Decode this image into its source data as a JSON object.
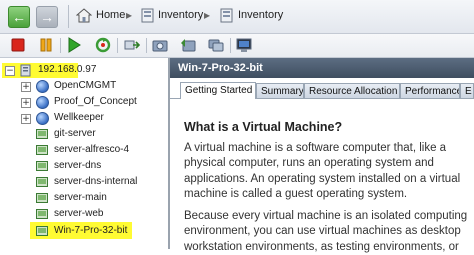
{
  "nav": {
    "back_icon": "back-arrow-icon",
    "forward_icon": "forward-arrow-icon",
    "breadcrumb": [
      {
        "label": "Home",
        "icon": "home-icon"
      },
      {
        "label": "Inventory",
        "icon": "inventory-icon"
      },
      {
        "label": "Inventory",
        "icon": "inventory-icon"
      }
    ]
  },
  "toolbar": {
    "buttons": [
      "stop-icon",
      "pause-icon",
      "play-icon",
      "reset-icon",
      "migrate-icon",
      "snapshot-icon",
      "revert-icon",
      "manage-snapshots-icon",
      "console-icon"
    ]
  },
  "tree": {
    "root": "192.168.0.97",
    "items": [
      {
        "label": "OpenCMGMT",
        "icon": "globe-icon",
        "expandable": true
      },
      {
        "label": "Proof_Of_Concept",
        "icon": "globe-icon",
        "expandable": true
      },
      {
        "label": "Wellkeeper",
        "icon": "globe-icon",
        "expandable": true
      },
      {
        "label": "git-server",
        "icon": "vm-icon",
        "expandable": false
      },
      {
        "label": "server-alfresco-4",
        "icon": "vm-icon",
        "expandable": false
      },
      {
        "label": "server-dns",
        "icon": "vm-icon",
        "expandable": false
      },
      {
        "label": "server-dns-internal",
        "icon": "vm-icon",
        "expandable": false
      },
      {
        "label": "server-main",
        "icon": "vm-icon",
        "expandable": false
      },
      {
        "label": "server-web",
        "icon": "vm-icon",
        "expandable": false
      },
      {
        "label": "Win-7-Pro-32-bit",
        "icon": "vm-icon",
        "expandable": false,
        "highlighted": true
      }
    ],
    "highlight_color": "#fffb33"
  },
  "vm": {
    "title": "Win-7-Pro-32-bit",
    "tabs": [
      "Getting Started",
      "Summary",
      "Resource Allocation",
      "Performance",
      "E"
    ],
    "active_tab": "Getting Started"
  },
  "page": {
    "heading": "What is a Virtual Machine?",
    "para1": [
      "A virtual machine is a software computer that, like a",
      "physical computer, runs an operating system and",
      "applications. An operating system installed on a virtual",
      "machine is called a guest operating system."
    ],
    "para2": [
      "Because every virtual machine is an isolated computing",
      "environment, you can use virtual machines as desktop",
      "workstation environments, as testing environments, or"
    ]
  }
}
